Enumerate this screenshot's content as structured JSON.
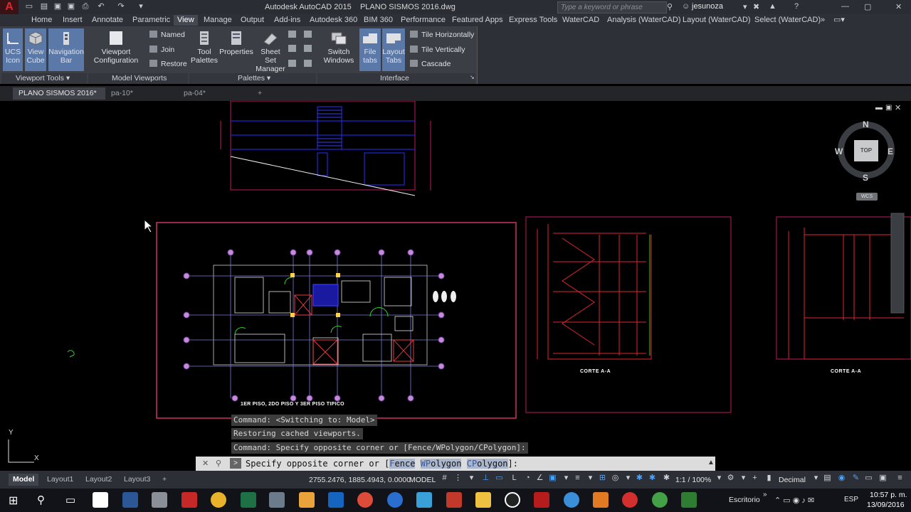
{
  "titlebar": {
    "app_title": "Autodesk AutoCAD 2015",
    "file_title": "PLANO SISMOS 2016.dwg",
    "search_placeholder": "Type a keyword or phrase",
    "user": "jesunoza"
  },
  "ribbon_tabs": [
    "Home",
    "Insert",
    "Annotate",
    "Parametric",
    "View",
    "Manage",
    "Output",
    "Add-ins",
    "Autodesk 360",
    "BIM 360",
    "Performance",
    "Featured Apps",
    "Express Tools",
    "WaterCAD",
    "Analysis (WaterCAD)",
    "Layout (WaterCAD)",
    "Select (WaterCAD)"
  ],
  "active_tab": "View",
  "ribbon": {
    "viewport_tools": {
      "label": "Viewport Tools",
      "ucs_icon": [
        "UCS",
        "Icon"
      ],
      "view_cube": [
        "View",
        "Cube"
      ],
      "navigation_bar": [
        "Navigation",
        "Bar"
      ]
    },
    "model_viewports": {
      "label": "Model Viewports",
      "viewport_configuration": [
        "Viewport",
        "Configuration"
      ],
      "named": "Named",
      "join": "Join",
      "restore": "Restore"
    },
    "palettes": {
      "label": "Palettes",
      "tool_palettes": [
        "Tool",
        "Palettes"
      ],
      "properties": "Properties",
      "sheet_set_manager": [
        "Sheet Set",
        "Manager"
      ]
    },
    "interface": {
      "label": "Interface",
      "switch_windows": [
        "Switch",
        "Windows"
      ],
      "file_tabs": [
        "File",
        "tabs"
      ],
      "layout_tabs": [
        "Layout",
        "Tabs"
      ],
      "tile_horizontally": "Tile Horizontally",
      "tile_vertically": "Tile Vertically",
      "cascade": "Cascade"
    }
  },
  "file_tabs": [
    {
      "label": "PLANO SISMOS 2016*",
      "active": true
    },
    {
      "label": "pa-10*",
      "active": false
    },
    {
      "label": "pa-04*",
      "active": false
    }
  ],
  "viewcube": {
    "north": "N",
    "south": "S",
    "east": "E",
    "west": "W",
    "face": "TOP",
    "wcs": "WCS"
  },
  "drawing": {
    "plan_title": "1ER PISO, 2DO PISO Y 3ER PISO TIPICO",
    "section_a": "CORTE A-A",
    "section_b": "CORTE A-A",
    "ucs_y": "Y",
    "ucs_x": "X"
  },
  "command_history": [
    "Command:   <Switching to: Model>",
    "Restoring cached viewports.",
    "Command: Specify opposite corner or [Fence/WPolygon/CPolygon]:"
  ],
  "command_input": {
    "prefix": "Specify opposite corner or [",
    "kw1_first": "F",
    "kw1_rest": "ence",
    "kw2_first": "WP",
    "kw2_rest": "olygon",
    "kw3_first": "CP",
    "kw3_rest": "olygon",
    "suffix": "]:"
  },
  "layout_tabs": [
    {
      "label": "Model",
      "active": true
    },
    {
      "label": "Layout1",
      "active": false
    },
    {
      "label": "Layout2",
      "active": false
    },
    {
      "label": "Layout3",
      "active": false
    }
  ],
  "status": {
    "coordinates": "2755.2476, 1885.4943, 0.0000",
    "space": "MODEL",
    "scale": "1:1 / 100%",
    "units": "Decimal"
  },
  "taskbar": {
    "desktop": "Escritorio",
    "language": "ESP",
    "time": "10:57 p. m.",
    "date": "13/09/2016"
  },
  "colors": {
    "accent_red": "#e0262f",
    "ribbon_bg": "#3b3e45",
    "selected_blue": "#5b79a8",
    "drawing_bg": "#000000"
  }
}
